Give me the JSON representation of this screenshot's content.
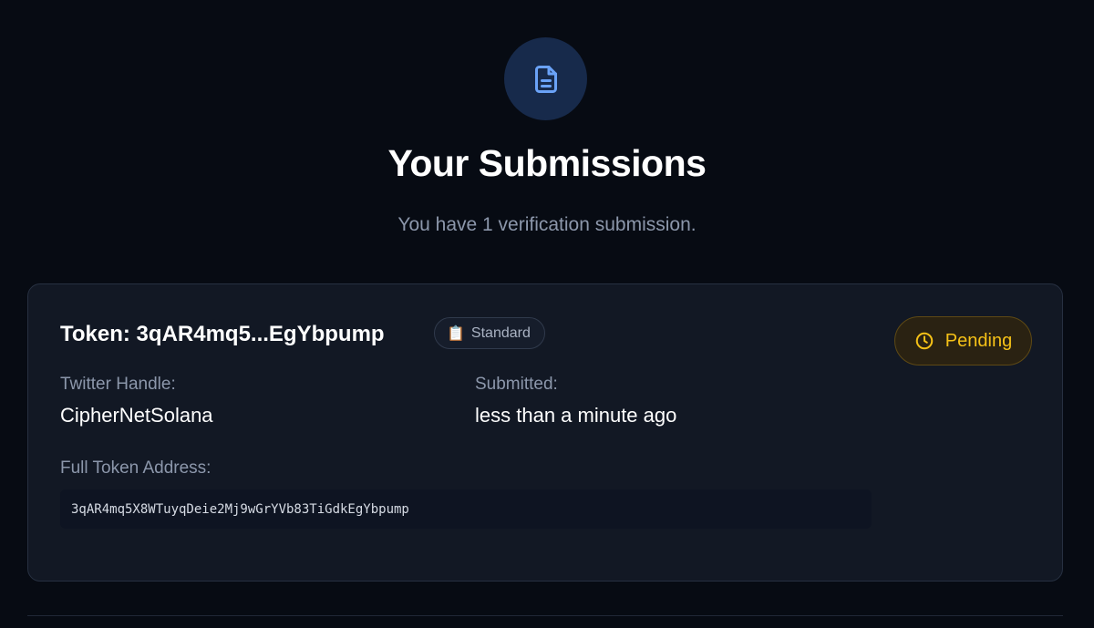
{
  "header": {
    "icon": "document-icon",
    "title": "Your Submissions",
    "subtitle": "You have 1 verification submission."
  },
  "submission": {
    "token_title": "Token: 3qAR4mq5...EgYbpump",
    "type_badge": {
      "icon": "clipboard-icon",
      "emoji": "📋",
      "label": "Standard"
    },
    "status": {
      "icon": "clock-icon",
      "label": "Pending",
      "color": "#f5c117"
    },
    "twitter_label": "Twitter Handle:",
    "twitter_value": "CipherNetSolana",
    "submitted_label": "Submitted:",
    "submitted_value": "less than a minute ago",
    "address_label": "Full Token Address:",
    "address_value": "3qAR4mq5X8WTuyqDeie2Mj9wGrYVb83TiGdkEgYbpump"
  },
  "colors": {
    "background": "#070b13",
    "card": "#121824",
    "accent_icon": "#6aa2f7",
    "pending": "#f5c117"
  }
}
